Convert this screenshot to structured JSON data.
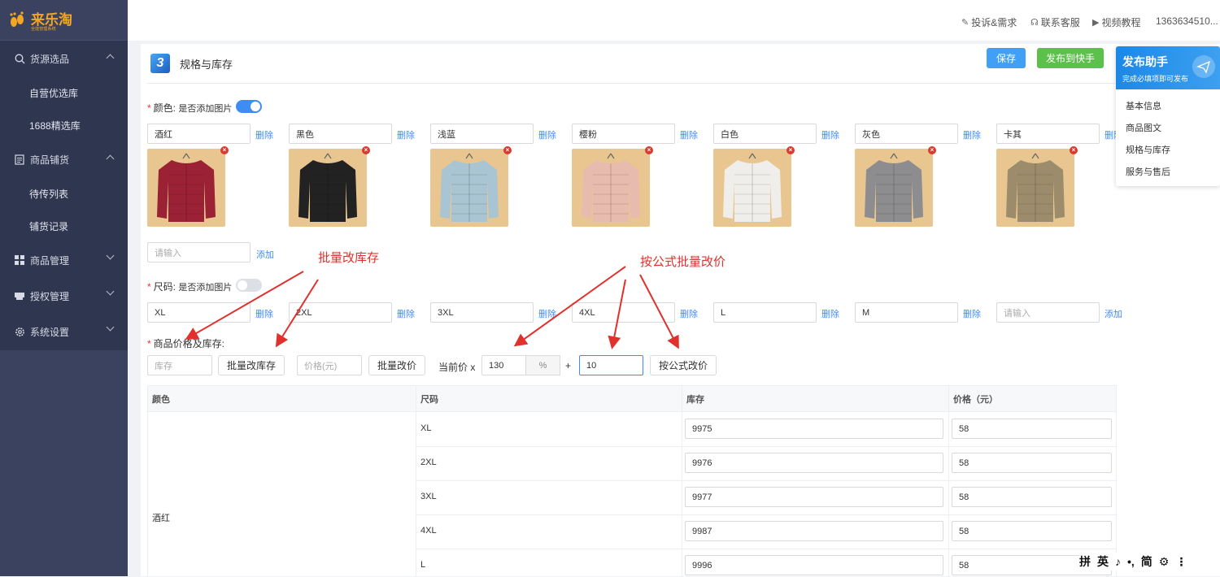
{
  "app": {
    "name": "来乐淘",
    "subtitle": "全能管理系统"
  },
  "sidebar": {
    "groups": [
      {
        "label": "货源选品",
        "icon": "search-icon",
        "expanded": true
      },
      {
        "label": "商品铺货",
        "icon": "document-icon",
        "expanded": true
      },
      {
        "label": "商品管理",
        "icon": "grid-icon",
        "expanded": false
      },
      {
        "label": "授权管理",
        "icon": "printer-icon",
        "expanded": false
      },
      {
        "label": "系统设置",
        "icon": "gear-icon",
        "expanded": false
      }
    ],
    "sub_items": [
      "自营优选库",
      "1688精选库",
      "待传列表",
      "铺货记录"
    ]
  },
  "topbar": {
    "complaint": "投诉&需求",
    "support": "联系客服",
    "tutorial": "视频教程",
    "account": "1363634510..."
  },
  "section": {
    "step": "3",
    "title": "规格与库存"
  },
  "actions": {
    "save": "保存",
    "publish": "发布到快手"
  },
  "helper": {
    "title": "发布助手",
    "subtitle": "完成必填项即可发布",
    "items": [
      "基本信息",
      "商品图文",
      "规格与库存",
      "服务与售后"
    ]
  },
  "color_spec": {
    "label": "颜色:",
    "toggle_label": "是否添加图片",
    "toggle_on": true,
    "values": [
      "酒红",
      "黑色",
      "浅蓝",
      "樱粉",
      "白色",
      "灰色",
      "卡其"
    ],
    "image_colors": [
      "#9b2135",
      "#222222",
      "#a9c4d2",
      "#e7bcae",
      "#efeeea",
      "#8d8d90",
      "#9c8c6c"
    ],
    "delete_label": "删除",
    "new_placeholder": "请输入",
    "add_label": "添加"
  },
  "size_spec": {
    "label": "尺码:",
    "toggle_label": "是否添加图片",
    "toggle_on": false,
    "values": [
      "XL",
      "2XL",
      "3XL",
      "4XL",
      "L",
      "M"
    ],
    "delete_label": "删除",
    "new_placeholder": "请输入",
    "add_label": "添加"
  },
  "price_stock": {
    "label": "商品价格及库存:",
    "stock_placeholder": "库存",
    "batch_stock_btn": "批量改库存",
    "price_placeholder": "价格(元)",
    "batch_price_btn": "批量改价",
    "current_price_label": "当前价 x",
    "multiplier": "130",
    "percent": "%",
    "plus": "+",
    "addend": "10",
    "formula_btn": "按公式改价"
  },
  "annotations": {
    "batch_stock": "批量改库存",
    "formula_price": "按公式批量改价"
  },
  "table": {
    "headers": [
      "颜色",
      "尺码",
      "库存",
      "价格（元）"
    ],
    "color_cell": "酒红",
    "rows": [
      {
        "size": "XL",
        "stock": "9975",
        "price": "58"
      },
      {
        "size": "2XL",
        "stock": "9976",
        "price": "58"
      },
      {
        "size": "3XL",
        "stock": "9977",
        "price": "58"
      },
      {
        "size": "4XL",
        "stock": "9987",
        "price": "58"
      },
      {
        "size": "L",
        "stock": "9996",
        "price": "58"
      }
    ]
  },
  "ime_bar": {
    "items": [
      "拼",
      "英",
      "♪",
      "•,",
      "简",
      "⚙",
      "⋮"
    ]
  }
}
